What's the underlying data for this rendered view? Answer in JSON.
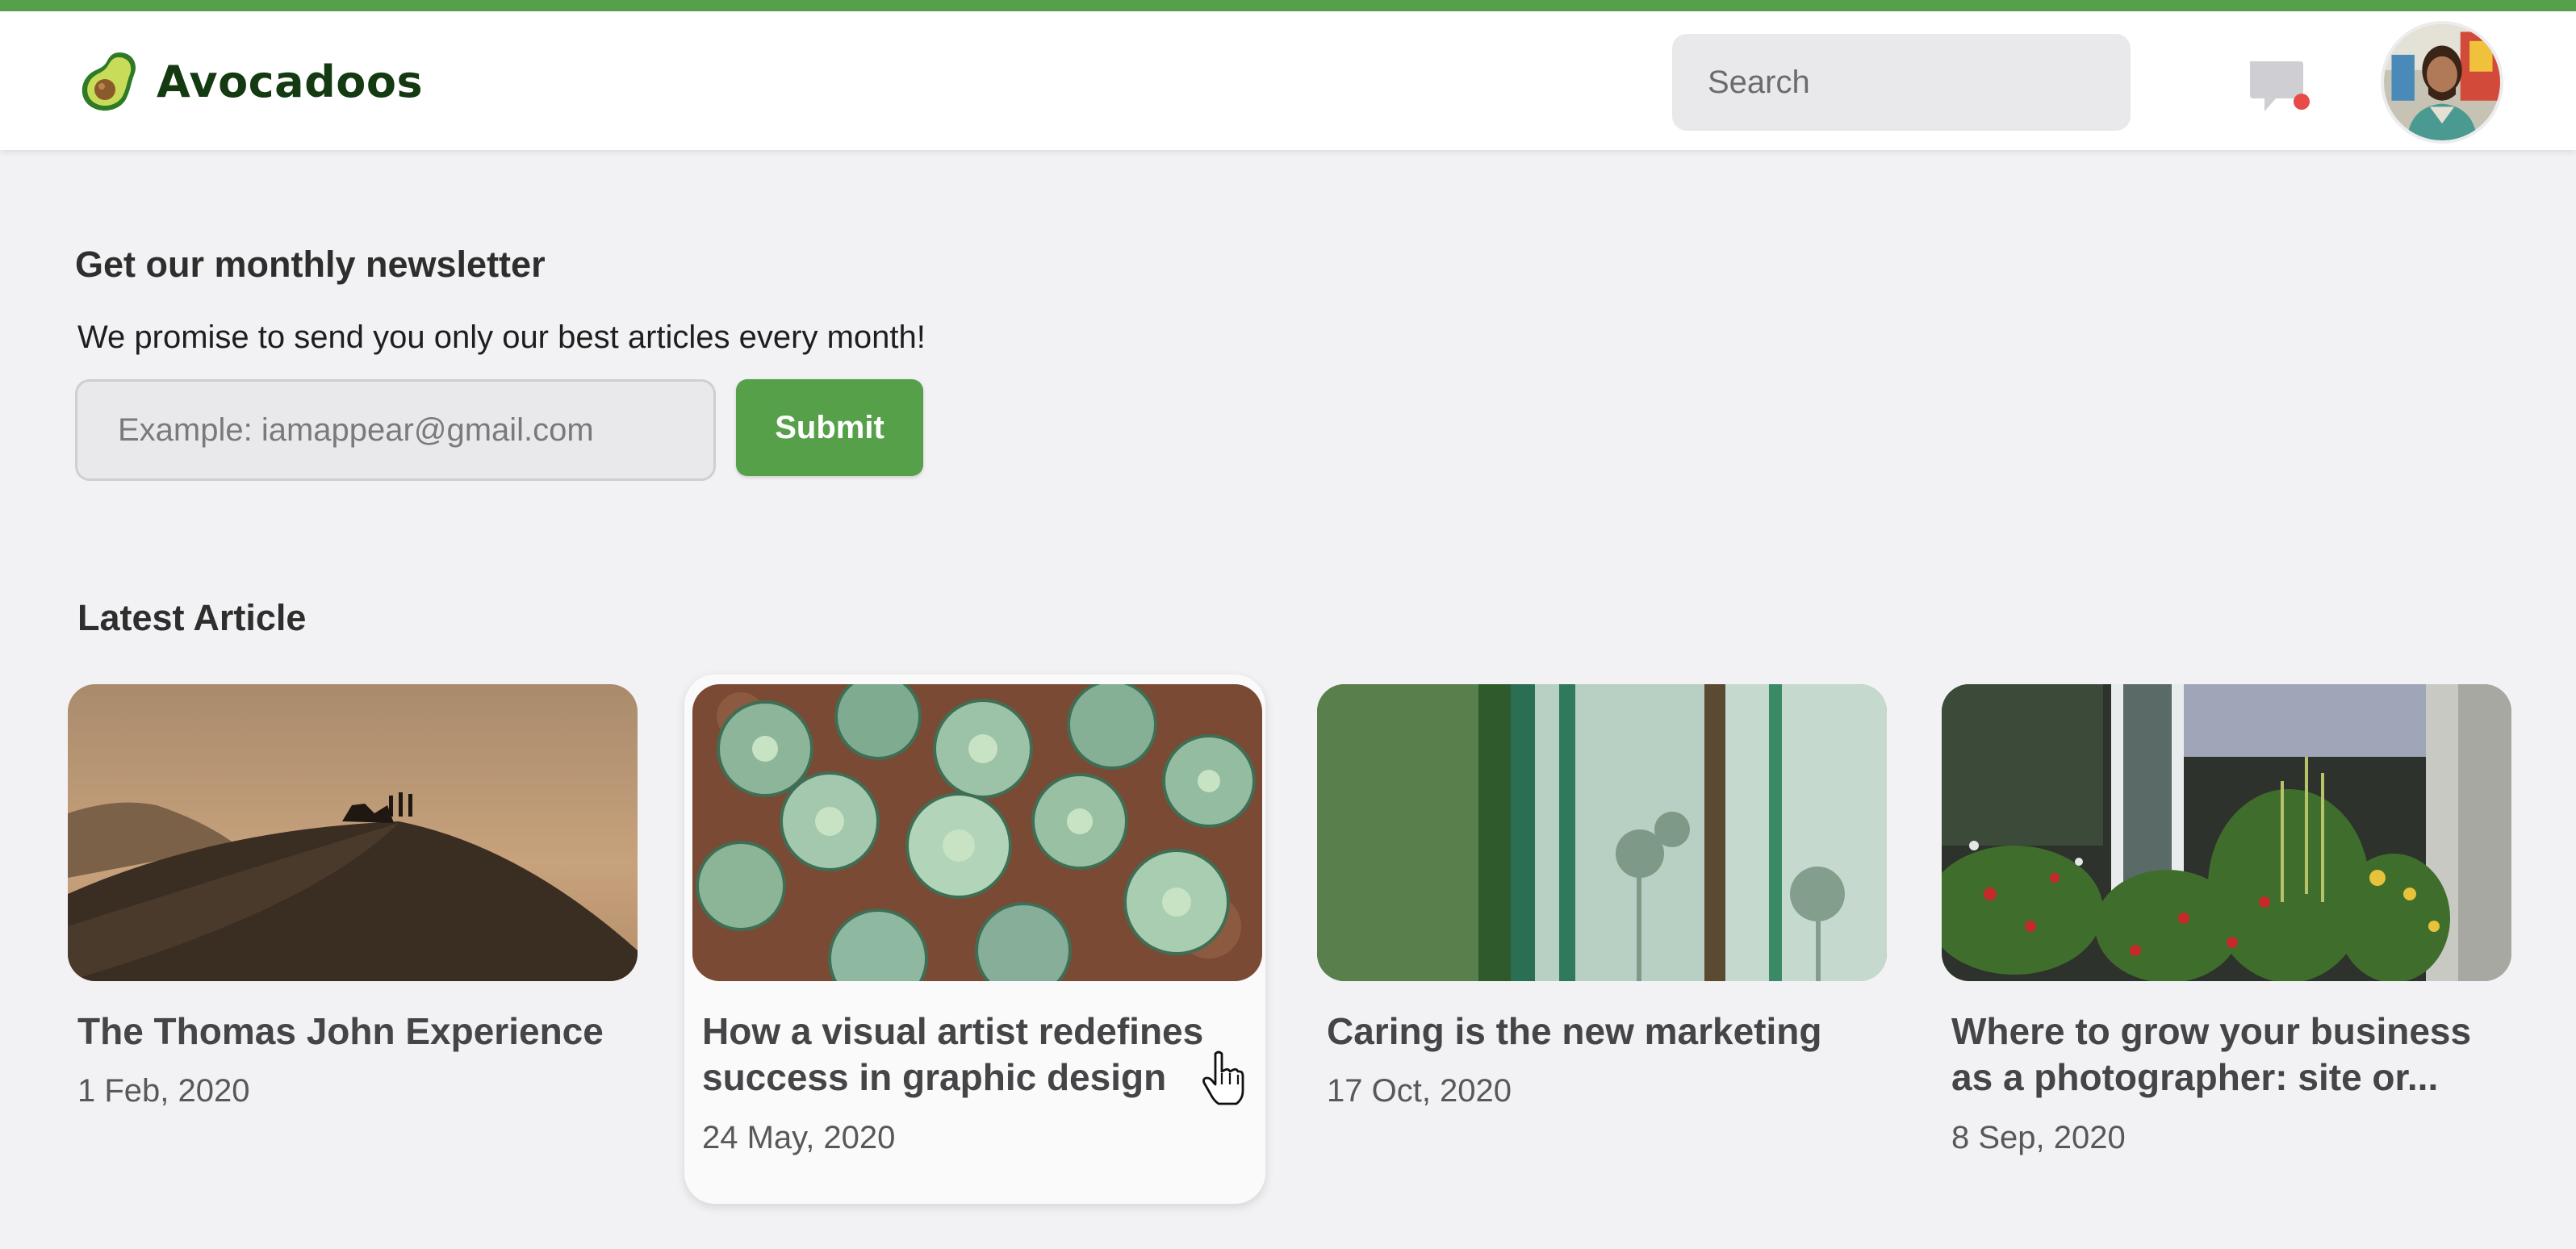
{
  "brand": {
    "name": "Avocadoos",
    "logo_icon": "avocado-logo-icon",
    "accent_color": "#56a04a"
  },
  "header": {
    "search_placeholder": "Search",
    "messages_icon": "chat-bubble-icon",
    "notification_dot_color": "#e84a4a",
    "avatar": "user-avatar"
  },
  "newsletter": {
    "title": "Get our monthly newsletter",
    "description": "We promise to send you only our best articles every month!",
    "email_placeholder": "Example: iamappear@gmail.com",
    "submit_label": "Submit"
  },
  "articles_section": {
    "title": "Latest Article",
    "articles": [
      {
        "title": "The Thomas John Experience",
        "date": "1 Feb, 2020",
        "image": "desert-dune-photo"
      },
      {
        "title": "How a visual artist redefines success in graphic design",
        "date": "24 May, 2020",
        "image": "cabbage-field-photo"
      },
      {
        "title": "Caring is the new marketing",
        "date": "17 Oct, 2020",
        "image": "green-curtain-photo"
      },
      {
        "title": "Where to grow your business as a photographer: site or...",
        "date": "8 Sep, 2020",
        "image": "window-flowers-photo"
      }
    ]
  },
  "cursor": "hand-pointer-icon"
}
